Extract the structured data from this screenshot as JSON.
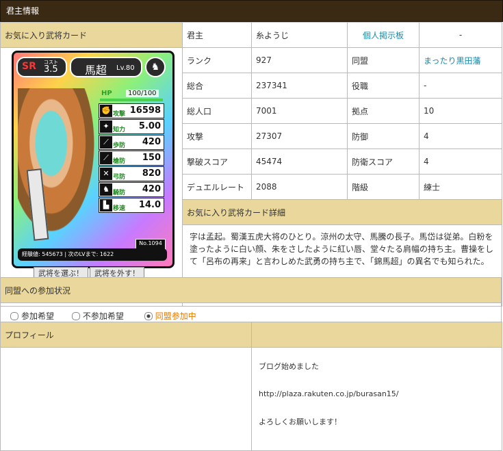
{
  "title": "君主情報",
  "card_header": "お気に入り武将カード",
  "card": {
    "rarity": "SR",
    "cost_label": "コスト",
    "cost": "3.5",
    "name": "馬超",
    "level": "Lv.80",
    "hp_label": "HP",
    "hp": "100/100",
    "hp_fraction": 1.0,
    "stats": [
      {
        "label": "攻撃",
        "value": "16598"
      },
      {
        "label": "知力",
        "value": "5.00"
      },
      {
        "label": "歩防",
        "value": "420"
      },
      {
        "label": "槍防",
        "value": "150"
      },
      {
        "label": "弓防",
        "value": "820"
      },
      {
        "label": "騎防",
        "value": "420"
      },
      {
        "label": "移速",
        "value": "14.0"
      }
    ],
    "number": "No.1094",
    "exp_text": "経験値: 545673 | 次のLVまで: 1622",
    "btn_select": "武将を選ぶ！",
    "btn_remove": "武将を外す！"
  },
  "rows": [
    {
      "k1": "君主",
      "v1": "糸ようじ",
      "k2": "個人掲示板",
      "v2": "-"
    },
    {
      "k1": "ランク",
      "v1": "927",
      "k2": "同盟",
      "v2": "まったり黒田藩"
    },
    {
      "k1": "総合",
      "v1": "237341",
      "k2": "役職",
      "v2": "-"
    },
    {
      "k1": "総人口",
      "v1": "7001",
      "k2": "拠点",
      "v2": "10"
    },
    {
      "k1": "攻撃",
      "v1": "27307",
      "k2": "防御",
      "v2": "4"
    },
    {
      "k1": "撃破スコア",
      "v1": "45474",
      "k2": "防衛スコア",
      "v2": "4"
    },
    {
      "k1": "デュエルレート",
      "v1": "2088",
      "k2": "階級",
      "v2": "練士"
    }
  ],
  "detail_header": "お気に入り武将カード詳細",
  "detail_text": "字は孟起。蜀漢五虎大将のひとり。涼州の太守、馬騰の長子。馬岱は従弟。白粉を塗ったように白い顔、朱をさしたように紅い唇、堂々たる肩幅の持ち主。曹操をして「呂布の再来」と言わしめた武勇の持ち主で、「錦馬超」の異名でも知られた。",
  "alliance": {
    "header": "同盟への参加状況",
    "opt1": "参加希望",
    "opt2": "不参加希望",
    "opt3": "同盟参加中",
    "selected": 3
  },
  "profile": {
    "header": "プロフィール",
    "line1": "ブログ始めました",
    "line2": "http://plaza.rakuten.co.jp/burasan15/",
    "line3": "よろしくお願いします！"
  }
}
